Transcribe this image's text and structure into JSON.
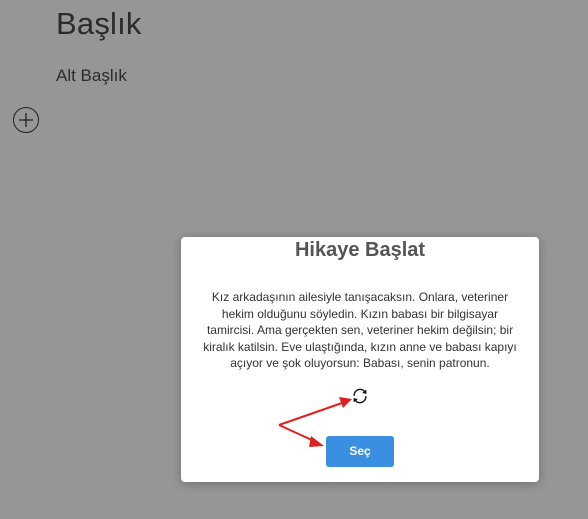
{
  "page": {
    "title": "Başlık",
    "subtitle": "Alt Başlık"
  },
  "modal": {
    "title": "Hikaye Başlat",
    "body": "Kız arkadaşının ailesiyle tanışacaksın. Onlara, veteriner hekim olduğunu söyledin. Kızın babası bir bilgisayar tamircisi. Ama gerçekten sen, veteriner hekim değilsin; bir kiralık katilsin. Eve ulaştığında, kızın anne ve babası kapıyı açıyor ve şok oluyorsun: Babası, senin patronun.",
    "refresh_icon": "refresh-icon",
    "select_label": "Seç"
  },
  "icons": {
    "add": "plus-icon",
    "refresh": "refresh-icon"
  },
  "colors": {
    "overlay": "#000000",
    "button": "#3b8fe0",
    "annotation_arrow": "#e02020"
  }
}
